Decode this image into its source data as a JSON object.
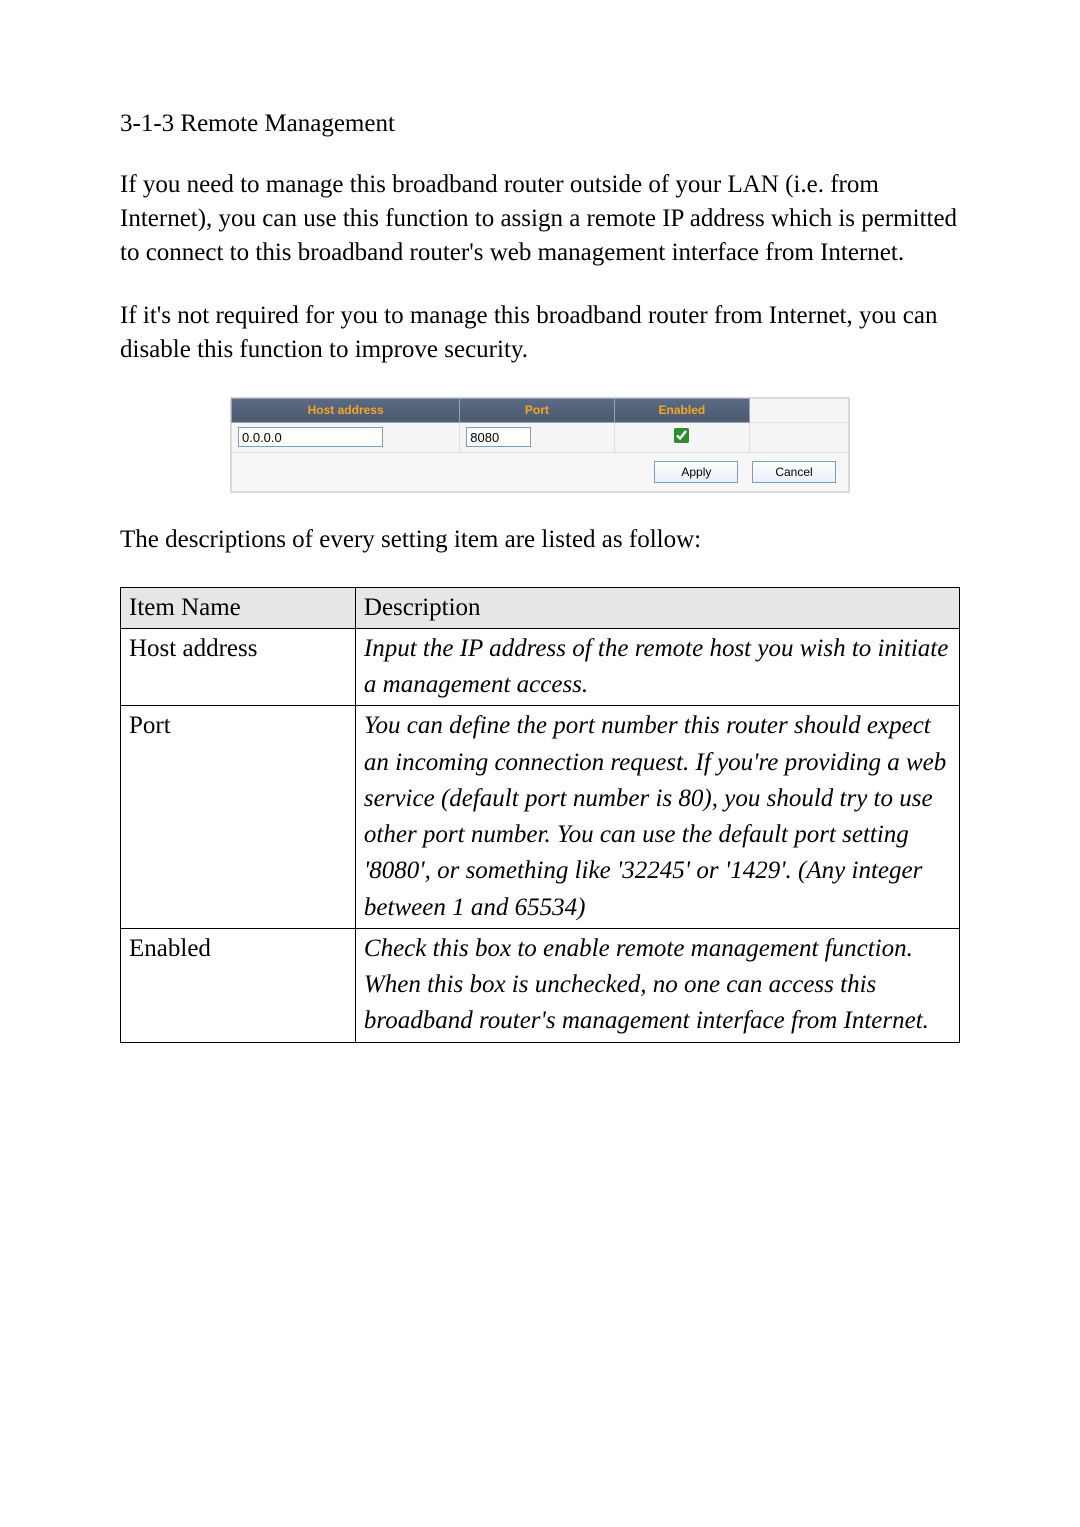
{
  "section_title": "3-1-3 Remote Management",
  "para1": "If you need to manage this broadband router outside of your LAN (i.e. from Internet), you can use this function to assign a remote IP address which is permitted to connect to this broadband router's web management interface from Internet.",
  "para2": "If it's not required for you to manage this broadband router from Internet, you can disable this function to improve security.",
  "router": {
    "headers": {
      "host": "Host address",
      "port": "Port",
      "enabled": "Enabled"
    },
    "host_value": "0.0.0.0",
    "port_value": "8080",
    "enabled_checked": true,
    "apply_label": "Apply",
    "cancel_label": "Cancel"
  },
  "para3": "The descriptions of every setting item are listed as follow:",
  "desc_table": {
    "header": {
      "c1": "Item Name",
      "c2": "Description"
    },
    "rows": [
      {
        "c1": "Host address",
        "c2": "Input the IP address of the remote host you wish to initiate a management access."
      },
      {
        "c1": "Port",
        "c2": "You can define the port number this router should expect an incoming connection request. If you're providing a web service (default port number is 80), you should try to use other port number. You can use the default port setting '8080', or something like '32245' or '1429'. (Any integer between 1 and 65534)"
      },
      {
        "c1": "Enabled",
        "c2": "Check this box to enable remote management function. When this box is unchecked, no one can access this broadband router's management interface from Internet."
      }
    ]
  }
}
